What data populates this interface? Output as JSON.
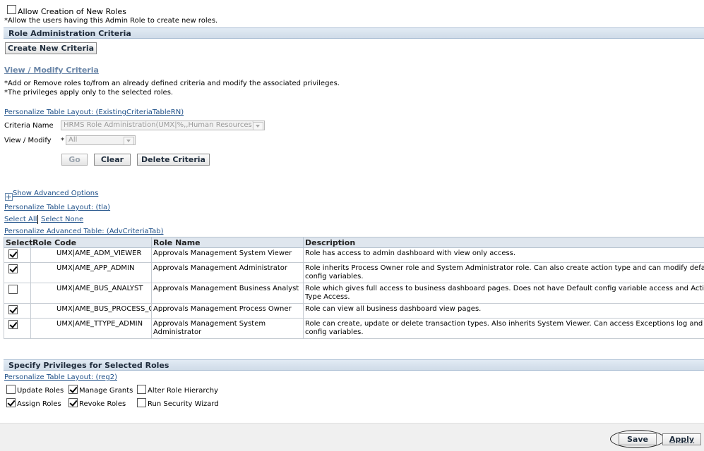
{
  "top": {
    "allow_creation_label": "Allow Creation of New Roles",
    "allow_creation_checked": false,
    "allow_creation_hint": "*Allow the users having this Admin Role to create new roles."
  },
  "criteria_section": {
    "title": "Role Administration Criteria",
    "create_button": "Create New Criteria",
    "view_modify_heading": "View / Modify Criteria",
    "hint1": "*Add or Remove roles to/from an already defined criteria and modify the associated privileges.",
    "hint2": "*The privileges apply only to the selected roles.",
    "personalize_link": "Personalize Table Layout: (ExistingCriteriaTableRN)",
    "criteria_name_label": "Criteria Name",
    "criteria_name_value": "HRMS Role Administration(UMX|%,,Human Resources)",
    "view_modify_label": "View / Modify",
    "view_modify_required": "*",
    "view_modify_value": "All",
    "go_button": "Go",
    "clear_button": "Clear",
    "delete_button": "Delete Criteria"
  },
  "advanced": {
    "show_advanced": "Show Advanced Options",
    "personalize_tla": "Personalize Table Layout: (tla)",
    "select_all": "Select All",
    "select_none": "Select None",
    "personalize_adv": "Personalize Advanced Table: (AdvCriteriaTab)"
  },
  "table": {
    "headers": {
      "select": "Select",
      "role_code": "Role Code",
      "role_name": "Role Name",
      "description": "Description"
    },
    "rows": [
      {
        "checked": true,
        "role_code": "UMX|AME_ADM_VIEWER",
        "role_name": "Approvals Management System Viewer",
        "description": "Role has access to admin dashboard with view only access."
      },
      {
        "checked": true,
        "role_code": "UMX|AME_APP_ADMIN",
        "role_name": "Approvals Management Administrator",
        "description": "Role inherits Process Owner role and System Administrator role. Can also create action type and can modify default config variables."
      },
      {
        "checked": false,
        "role_code": "UMX|AME_BUS_ANALYST",
        "role_name": "Approvals Management Business Analyst",
        "description": "Role which gives full access to business dashboard pages. Does not have Default config variable access and Action Type Access."
      },
      {
        "checked": true,
        "role_code": "UMX|AME_BUS_PROCESS_OWNER",
        "role_name": "Approvals Management Process Owner",
        "description": "Role can view all business dashboard view pages."
      },
      {
        "checked": true,
        "role_code": "UMX|AME_TTYPE_ADMIN",
        "role_name": "Approvals Management System Administrator",
        "description": "Role can create, update or delete transaction types. Also inherits System Viewer. Can access Exceptions log and config variables."
      }
    ]
  },
  "privileges": {
    "title": "Specify Privileges for Selected Roles",
    "personalize_link": "Personalize Table Layout: (reg2)",
    "items": [
      {
        "label": "Update Roles",
        "checked": false
      },
      {
        "label": "Manage Grants",
        "checked": true
      },
      {
        "label": "Alter Role Hierarchy",
        "checked": false
      },
      {
        "label": "Assign Roles",
        "checked": true
      },
      {
        "label": "Revoke Roles",
        "checked": true
      },
      {
        "label": "Run Security Wizard",
        "checked": false
      }
    ]
  },
  "footer": {
    "save_button": "Save",
    "apply_button": "Apply"
  }
}
